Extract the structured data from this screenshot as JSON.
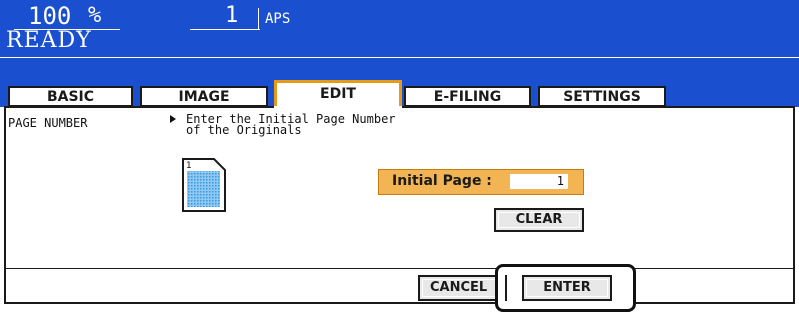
{
  "header": {
    "zoom_value": "100",
    "zoom_unit": "%",
    "copy_count": "1",
    "paper_mode": "APS",
    "status": "READY",
    "background_color": "#1a4fd0"
  },
  "tabs": [
    {
      "label": "BASIC",
      "active": false
    },
    {
      "label": "IMAGE",
      "active": false
    },
    {
      "label": "EDIT",
      "active": true
    },
    {
      "label": "E-FILING",
      "active": false
    },
    {
      "label": "SETTINGS",
      "active": false
    }
  ],
  "content": {
    "section_label": "PAGE NUMBER",
    "instruction_line1": "Enter the Initial Page Number",
    "instruction_line2": "of the Originals",
    "doc_icon_page_number": "1",
    "initial_page": {
      "label": "Initial Page :",
      "value": "1"
    },
    "clear_label": "CLEAR",
    "cancel_label": "CANCEL",
    "enter_label": "ENTER"
  },
  "colors": {
    "accent": "#e59a18",
    "initial_page_fill": "#f3b554",
    "doc_icon_fill": "#3a9ae0"
  }
}
